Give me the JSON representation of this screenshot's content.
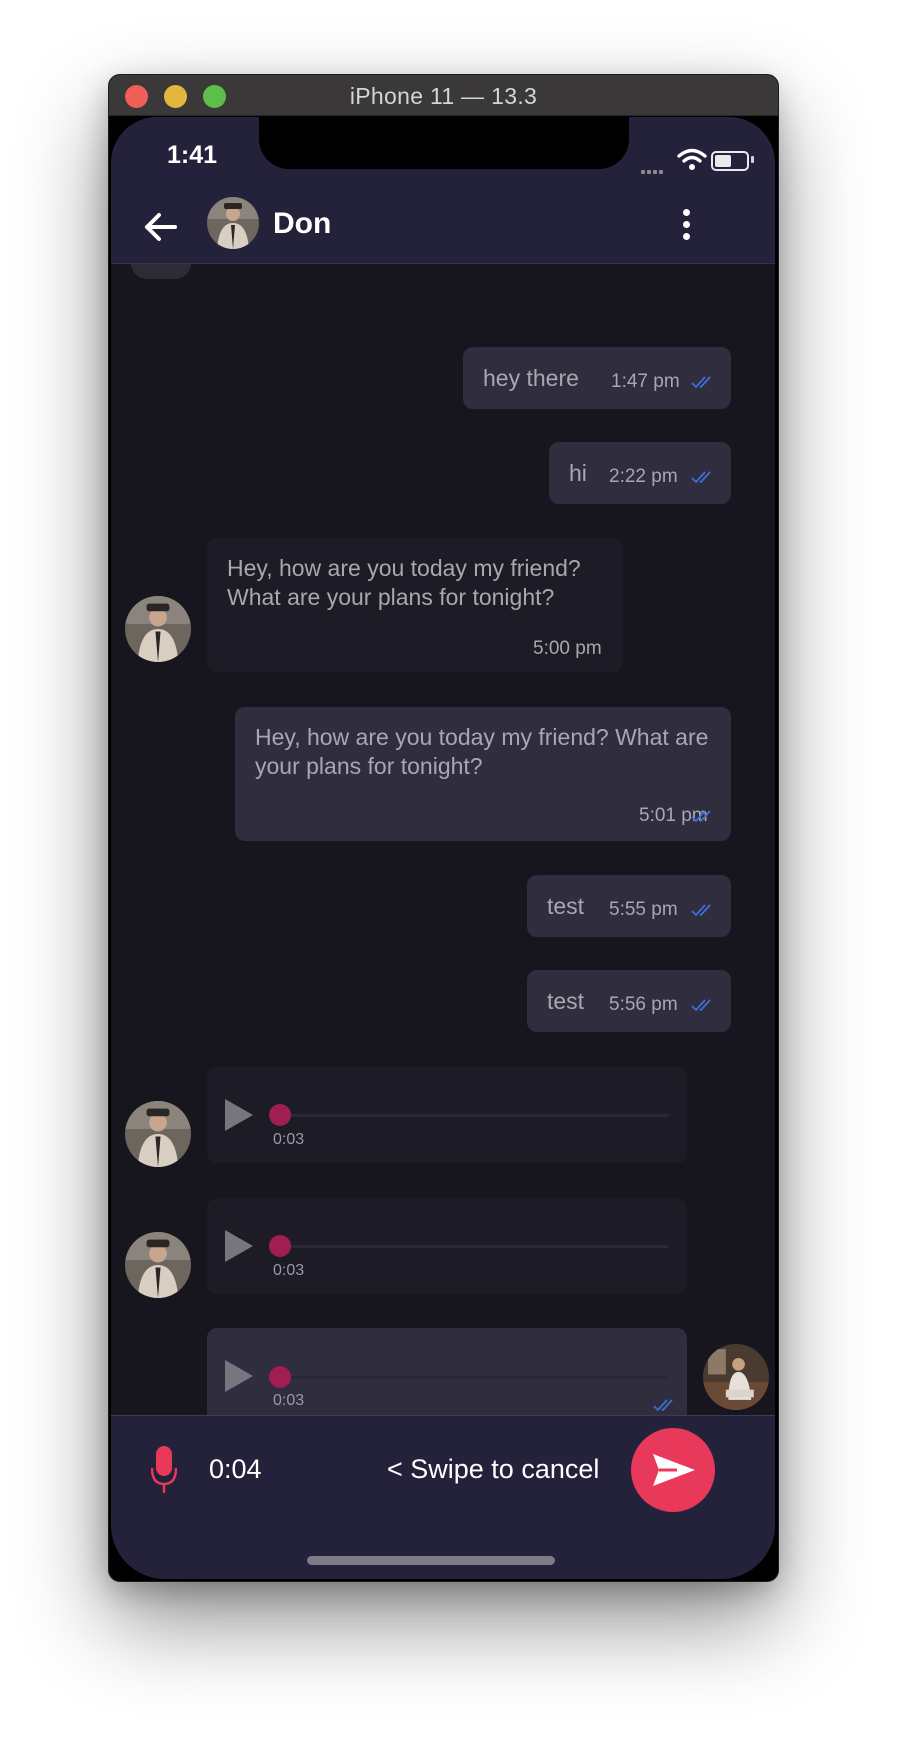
{
  "window": {
    "title": "iPhone 11 — 13.3"
  },
  "status_bar": {
    "time": "1:41"
  },
  "header": {
    "name": "Don",
    "back_icon": "arrow-left-icon",
    "menu_icon": "more-vertical-icon"
  },
  "messages": [
    {
      "direction": "outgoing",
      "text": "hey there",
      "time": "1:47 pm",
      "read": true
    },
    {
      "direction": "outgoing",
      "text": "hi",
      "time": "2:22 pm",
      "read": true
    },
    {
      "direction": "incoming",
      "text": "Hey, how are you today my friend? What are your plans for tonight?",
      "time": "5:00 pm"
    },
    {
      "direction": "outgoing",
      "text": "Hey, how are you today my friend? What are your plans for tonight?",
      "time": "5:01 pm",
      "read": true
    },
    {
      "direction": "outgoing",
      "text": "test",
      "time": "5:55 pm",
      "read": true
    },
    {
      "direction": "outgoing",
      "text": "test",
      "time": "5:56 pm",
      "read": true
    },
    {
      "direction": "incoming",
      "type": "audio",
      "duration": "0:03",
      "progress": 0
    },
    {
      "direction": "incoming",
      "type": "audio",
      "duration": "0:03",
      "progress": 0
    },
    {
      "direction": "outgoing",
      "type": "audio",
      "duration": "0:03",
      "progress": 0,
      "read": true
    }
  ],
  "composer": {
    "mic_icon": "microphone-icon",
    "recording_time": "0:04",
    "swipe_hint": "< Swipe to cancel",
    "send_icon": "send-icon"
  },
  "colors": {
    "accent": "#e8395a",
    "tick": "#3d6fd6",
    "audio_knob": "#a01e52",
    "header_bg": "#24223a",
    "chat_bg": "#17161f"
  }
}
